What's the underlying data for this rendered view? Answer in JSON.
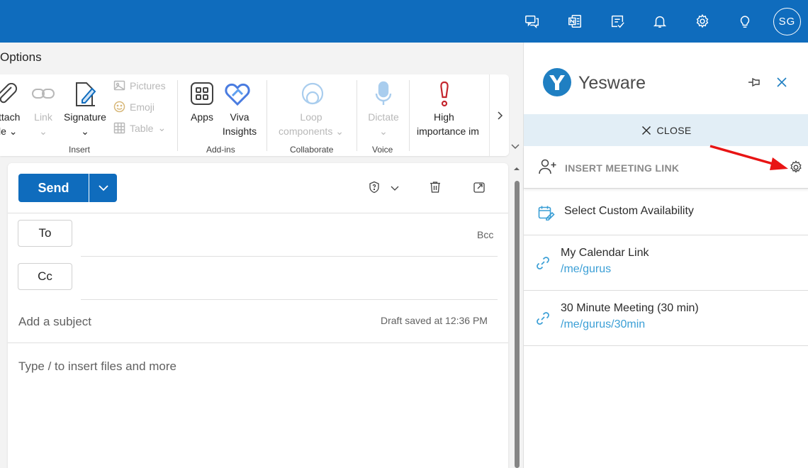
{
  "topbar": {
    "icons": [
      "chat-icon",
      "onenote-icon",
      "todo-icon",
      "bell-icon",
      "settings-icon",
      "lightbulb-icon"
    ],
    "avatar_initials": "SG"
  },
  "tab": {
    "label": "Options"
  },
  "ribbon": {
    "attach_line1": "ttach",
    "attach_line2": "le",
    "link_label": "Link",
    "signature_label": "Signature",
    "pictures_label": "Pictures",
    "emoji_label": "Emoji",
    "table_label": "Table",
    "insert_group": "Insert",
    "apps_label": "Apps",
    "viva_line1": "Viva",
    "viva_line2": "Insights",
    "addins_group": "Add-ins",
    "loop_line1": "Loop",
    "loop_line2": "components",
    "collaborate_group": "Collaborate",
    "dictate_label": "Dictate",
    "voice_group": "Voice",
    "importance_line1": "High",
    "importance_line2": "importance",
    "importance_cut": "im"
  },
  "compose": {
    "send_label": "Send",
    "to_label": "To",
    "cc_label": "Cc",
    "bcc_label": "Bcc",
    "subject_placeholder": "Add a subject",
    "draft_status": "Draft saved at 12:36 PM",
    "body_placeholder": "Type / to insert files and more"
  },
  "yesware": {
    "brand_name": "Yesware",
    "close_label": "CLOSE",
    "insert_meeting_label": "INSERT MEETING LINK",
    "custom_availability": "Select Custom Availability",
    "links": [
      {
        "title": "My Calendar Link",
        "path": "/me/gurus"
      },
      {
        "title": "30 Minute Meeting (30 min)",
        "path": "/me/gurus/30min"
      }
    ]
  },
  "colors": {
    "brand_blue": "#0f6cbd",
    "yesware_blue": "#1f7fc2",
    "link_blue": "#3b9fd6",
    "annotation_red": "#e81414"
  }
}
